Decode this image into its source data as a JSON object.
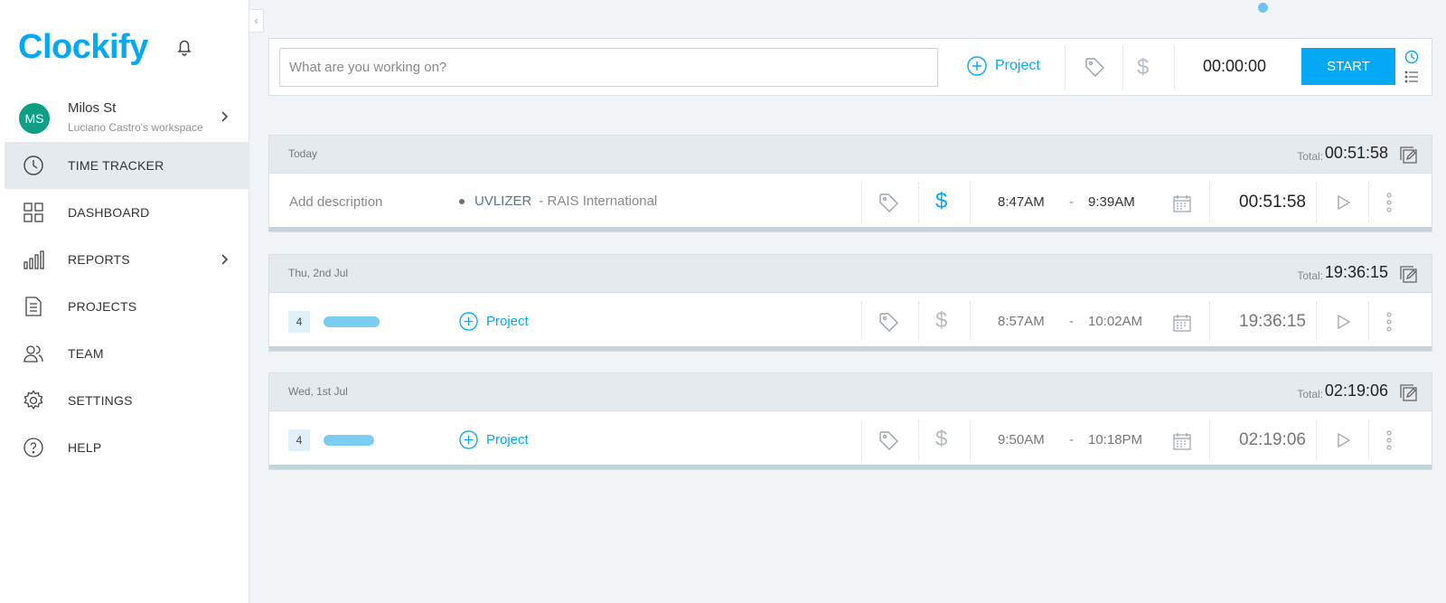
{
  "app": {
    "logo_text": "Clockify",
    "accent": "#03a9f4"
  },
  "user": {
    "initials": "MS",
    "name": "Milos St",
    "workspace": "Luciano Castro's workspace"
  },
  "nav": [
    {
      "label": "TIME TRACKER",
      "icon": "clock-icon",
      "active": true
    },
    {
      "label": "DASHBOARD",
      "icon": "dashboard-icon"
    },
    {
      "label": "REPORTS",
      "icon": "reports-icon",
      "has_submenu": true
    },
    {
      "label": "PROJECTS",
      "icon": "projects-icon"
    },
    {
      "label": "TEAM",
      "icon": "team-icon"
    },
    {
      "label": "SETTINGS",
      "icon": "gear-icon"
    },
    {
      "label": "HELP",
      "icon": "help-icon"
    }
  ],
  "tracker": {
    "placeholder": "What are you working on?",
    "project_label": "Project",
    "time": "00:00:00",
    "start_label": "START"
  },
  "groups": [
    {
      "date": "Today",
      "total_label": "Total:",
      "total": "00:51:58",
      "entry": {
        "description": "Add description",
        "project": "UVLIZER",
        "client": "- RAIS International",
        "billable": true,
        "start": "8:47AM",
        "dash": "-",
        "end": "9:39AM",
        "duration": "00:51:58"
      }
    },
    {
      "date": "Thu, 2nd Jul",
      "total_label": "Total:",
      "total": "19:36:15",
      "entry": {
        "count": "4",
        "project_label": "Project",
        "billable": false,
        "start": "8:57AM",
        "dash": "-",
        "end": "10:02AM",
        "duration": "19:36:15"
      }
    },
    {
      "date": "Wed, 1st Jul",
      "total_label": "Total:",
      "total": "02:19:06",
      "entry": {
        "count": "4",
        "project_label": "Project",
        "billable": false,
        "start": "9:50AM",
        "dash": "-",
        "end": "10:18PM",
        "duration": "02:19:06"
      }
    }
  ]
}
